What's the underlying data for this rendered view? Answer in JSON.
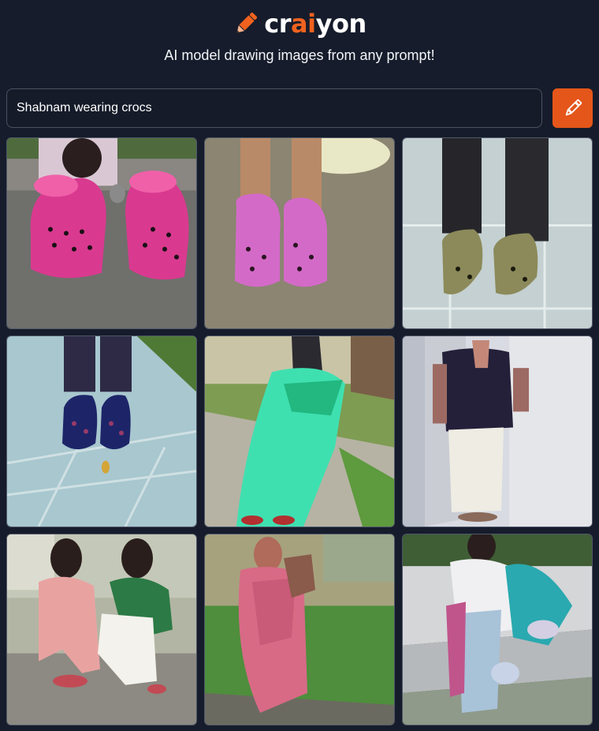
{
  "header": {
    "brand": {
      "pre": "cr",
      "accent": "ai",
      "post": "yon"
    },
    "tagline": "AI model drawing images from any prompt!"
  },
  "search": {
    "value": "Shabnam wearing crocs",
    "placeholder": ""
  },
  "draw_button": {
    "icon": "pencil-icon"
  },
  "colors": {
    "background": "#161c2b",
    "accent": "#f0621e",
    "button": "#e4561a",
    "border": "#4a5263"
  },
  "results": [
    {
      "subject": "pink clogs on pavement"
    },
    {
      "subject": "pink clogs on sand"
    },
    {
      "subject": "olive clogs on tiles"
    },
    {
      "subject": "navy clogs on tiles"
    },
    {
      "subject": "green saree on path"
    },
    {
      "subject": "white skirt in hallway"
    },
    {
      "subject": "two women in sarees seated"
    },
    {
      "subject": "pink saree on lawn"
    },
    {
      "subject": "woman seated on steps"
    }
  ]
}
